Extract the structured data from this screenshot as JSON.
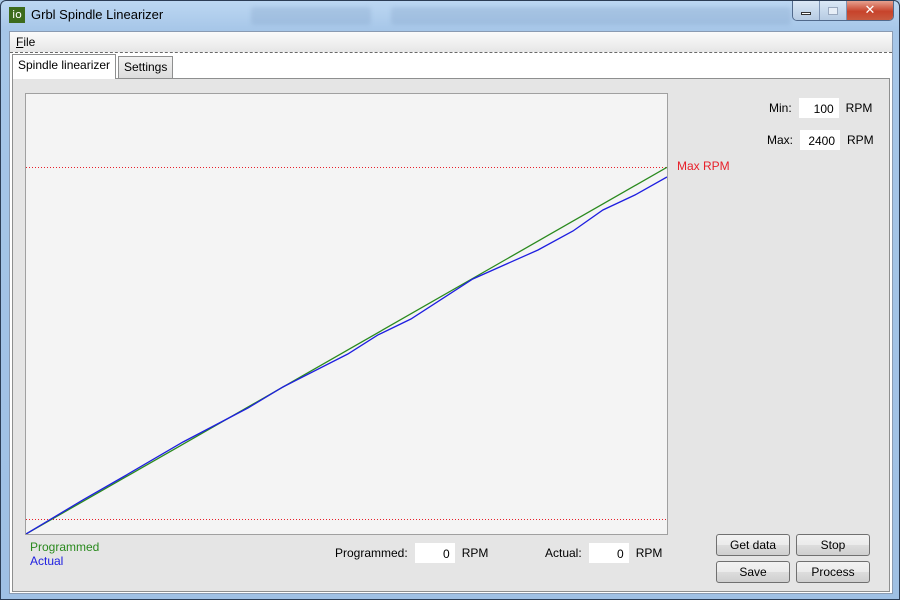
{
  "window": {
    "title": "Grbl Spindle Linearizer",
    "app_icon_text": "io",
    "caption_buttons": [
      "minimize",
      "maximize",
      "close"
    ],
    "close_glyph": "✕"
  },
  "menu": {
    "items": [
      {
        "label": "File",
        "accelerator": "F",
        "rest": "ile"
      }
    ]
  },
  "tabs": [
    {
      "label": "Spindle linearizer",
      "active": true
    },
    {
      "label": "Settings",
      "active": false
    }
  ],
  "range": {
    "min_label": "Min:",
    "min_value": "100",
    "max_label": "Max:",
    "max_value": "2400",
    "unit": "RPM"
  },
  "readout": {
    "programmed_label": "Programmed:",
    "programmed_value": "0",
    "actual_label": "Actual:",
    "actual_value": "0",
    "unit": "RPM"
  },
  "buttons": {
    "get_data": "Get data",
    "stop": "Stop",
    "save": "Save",
    "process": "Process"
  },
  "colors": {
    "programmed": "#2a8a1e",
    "actual": "#1e1ee0",
    "limit": "#e8202a"
  },
  "chart_data": {
    "type": "line",
    "title": "",
    "xlabel": "",
    "ylabel": "",
    "xlim": [
      0,
      2400
    ],
    "ylim": [
      0,
      2880
    ],
    "grid": false,
    "legend": "bottom-left",
    "legend_entries": [
      "Programmed",
      "Actual"
    ],
    "annotations": [
      {
        "type": "hline",
        "value": 2400,
        "label": "Max RPM",
        "style": "dotted"
      },
      {
        "type": "hline",
        "value": 100,
        "label": "",
        "style": "dotted"
      }
    ],
    "series": [
      {
        "name": "Programmed",
        "x": [
          0,
          2400
        ],
        "values": [
          0,
          2400
        ]
      },
      {
        "name": "Actual",
        "x": [
          0,
          213,
          363,
          588,
          831,
          962,
          1205,
          1317,
          1441,
          1673,
          1917,
          2048,
          2160,
          2280,
          2400
        ],
        "values": [
          0,
          223,
          373,
          602,
          825,
          962,
          1178,
          1302,
          1407,
          1669,
          1859,
          1983,
          2121,
          2219,
          2337
        ]
      }
    ]
  }
}
